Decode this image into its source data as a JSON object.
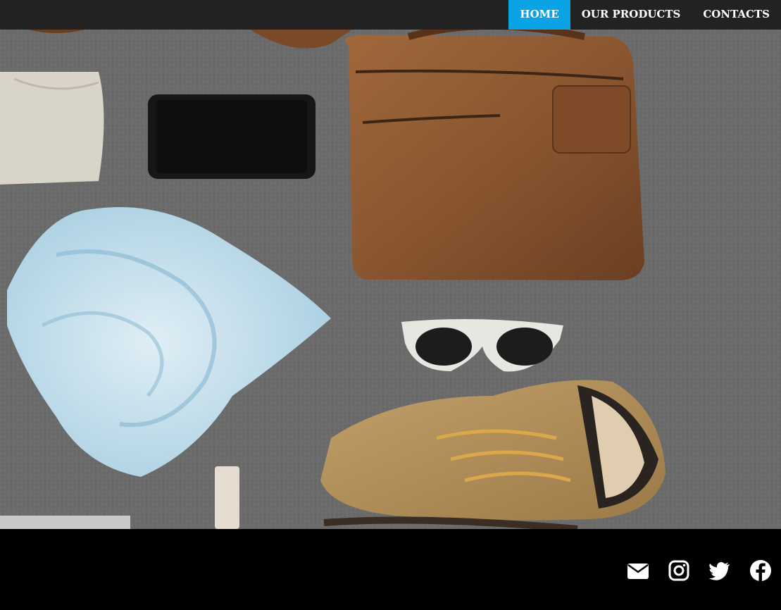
{
  "nav": {
    "items": [
      {
        "label": "HOME",
        "active": true
      },
      {
        "label": "OUR PRODUCTS",
        "active": false
      },
      {
        "label": "CONTACTS",
        "active": false
      }
    ],
    "accent_color": "#0aa3e6"
  },
  "hero": {
    "image_subject": "flat lay of travel accessories on grey felt"
  },
  "footer": {
    "social_icons": [
      "envelope-icon",
      "instagram-icon",
      "twitter-icon",
      "facebook-icon"
    ]
  }
}
